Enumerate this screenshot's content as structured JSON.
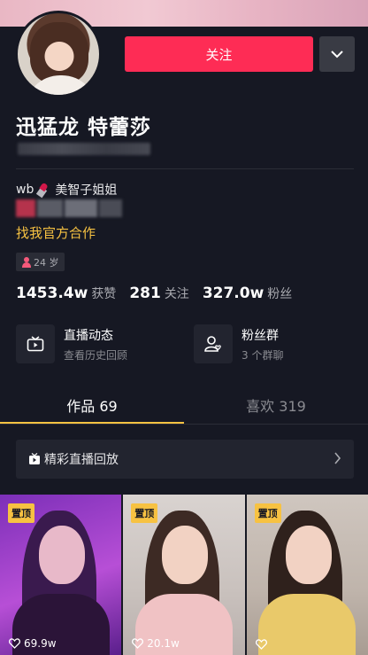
{
  "profile": {
    "name": "迅猛龙 特蕾莎",
    "signature_prefix": "wb",
    "signature_name": "美智子姐姐",
    "cooperation_link": "找我官方合作",
    "age": "24 岁"
  },
  "actions": {
    "follow_label": "关注"
  },
  "stats": {
    "likes_value": "1453.4w",
    "likes_label": "获赞",
    "following_value": "281",
    "following_label": "关注",
    "fans_value": "327.0w",
    "fans_label": "粉丝"
  },
  "features": [
    {
      "title": "直播动态",
      "subtitle": "查看历史回顾",
      "icon": "live-tv-icon"
    },
    {
      "title": "粉丝群",
      "subtitle": "3 个群聊",
      "icon": "fan-group-icon"
    }
  ],
  "tabs": [
    {
      "label": "作品 69",
      "active": true
    },
    {
      "label": "喜欢 319",
      "active": false
    }
  ],
  "replay": {
    "label": "精彩直播回放"
  },
  "videos": [
    {
      "pinned_label": "置顶",
      "likes": "69.9w"
    },
    {
      "pinned_label": "置顶",
      "likes": "20.1w"
    },
    {
      "pinned_label": "置顶",
      "likes": ""
    }
  ],
  "colors": {
    "background": "#161823",
    "accent_red": "#fe2c55",
    "accent_yellow": "#f7c242"
  }
}
